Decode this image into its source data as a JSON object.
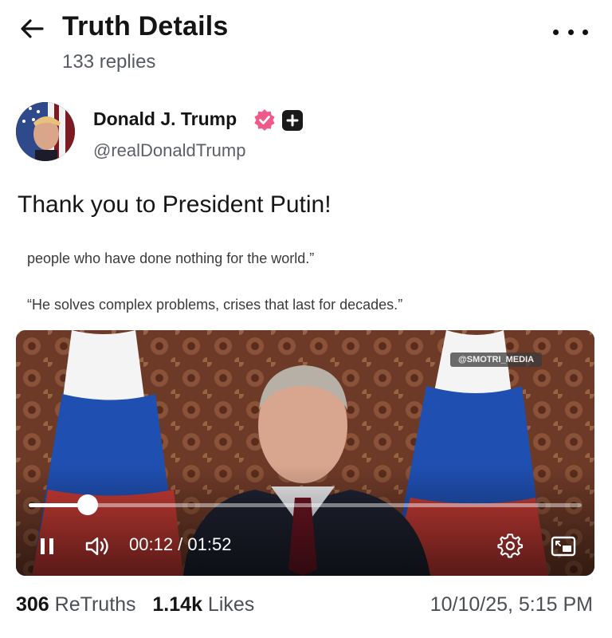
{
  "header": {
    "title": "Truth Details",
    "replies": "133 replies",
    "back_icon": "arrow-left-icon",
    "more_icon": "more-horizontal-icon"
  },
  "author": {
    "name": "Donald J. Trump",
    "handle": "@realDonaldTrump",
    "verified_color": "#f05a8a"
  },
  "post": {
    "text": "Thank you to President Putin!",
    "quote_line_1": "people who have done nothing for the world.”",
    "quote_line_2": "“He solves complex problems, crises that last for decades.”"
  },
  "video": {
    "watermark": "@SMOTRI_MEDIA",
    "current_time": "00:12",
    "duration": "01:52",
    "time_text": "00:12 / 01:52",
    "progress_fraction": 0.107,
    "state": "playing"
  },
  "stats": {
    "retruths_count": "306",
    "retruths_label": "ReTruths",
    "likes_count": "1.14k",
    "likes_label": "Likes",
    "timestamp": "10/10/25, 5:15 PM"
  }
}
